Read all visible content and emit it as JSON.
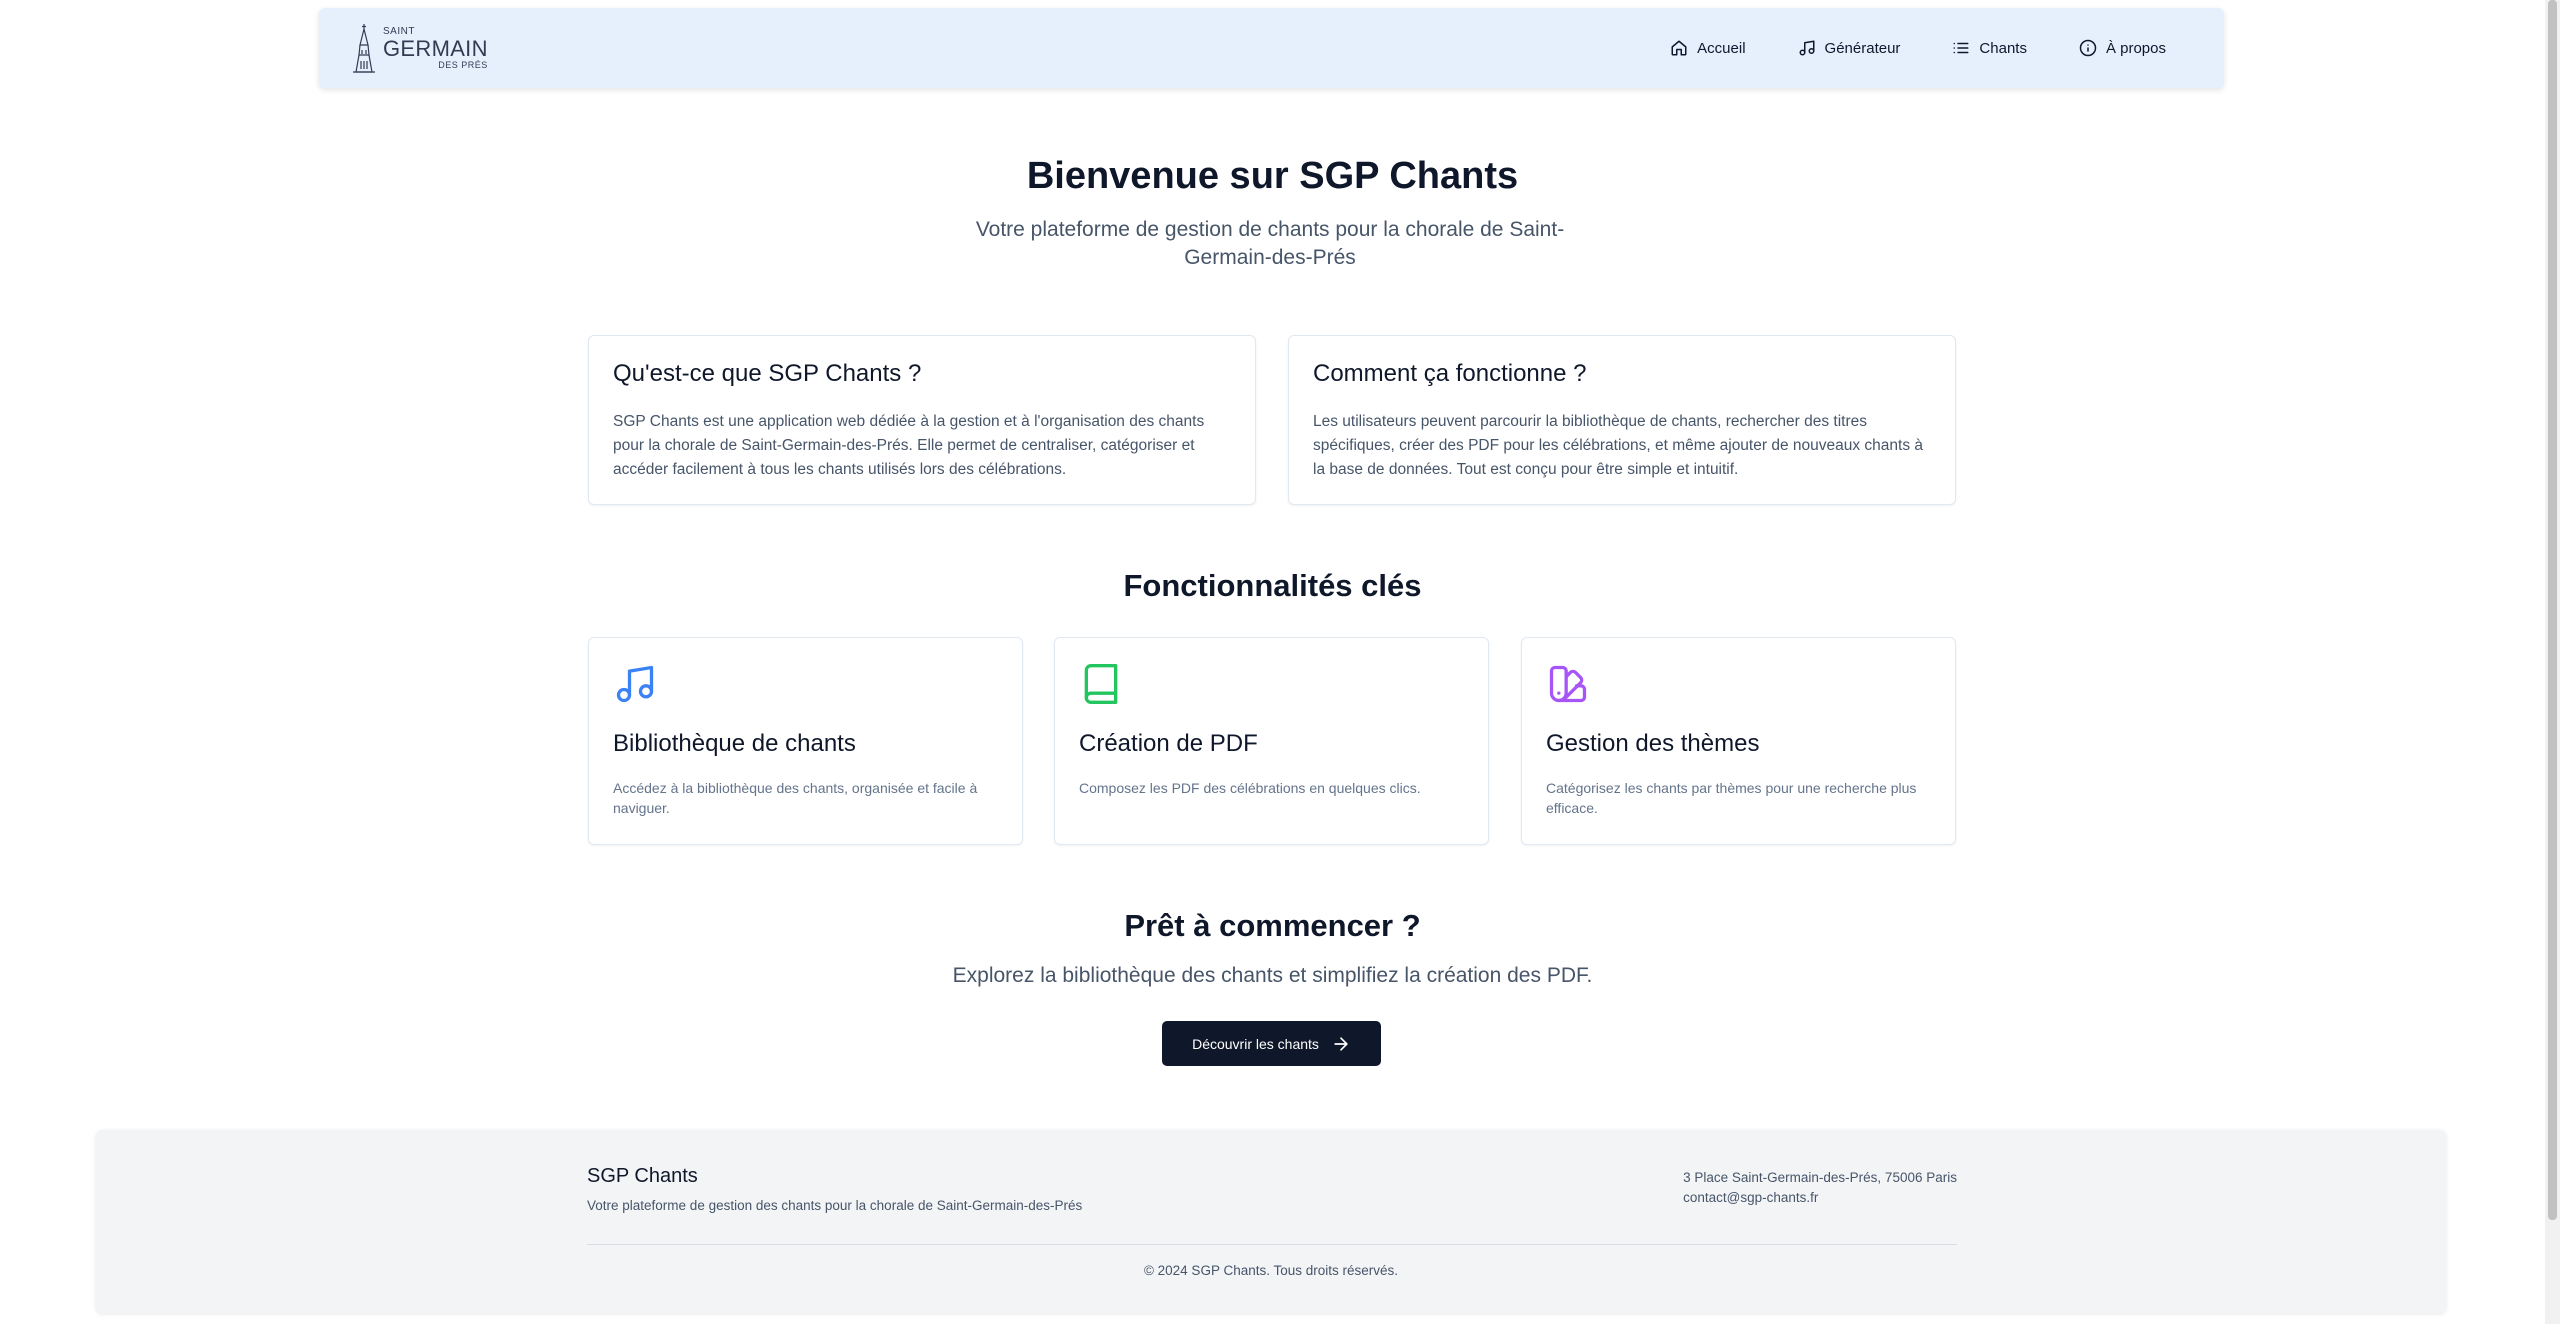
{
  "logo": {
    "saint": "SAINT",
    "germain": "GERMAIN",
    "des": "DES PRÉS"
  },
  "nav": [
    {
      "label": "Accueil",
      "icon": "home-icon"
    },
    {
      "label": "Générateur",
      "icon": "music-icon"
    },
    {
      "label": "Chants",
      "icon": "list-icon"
    },
    {
      "label": "À propos",
      "icon": "info-icon"
    }
  ],
  "hero": {
    "title": "Bienvenue sur SGP Chants",
    "subtitle": "Votre plateforme de gestion de chants pour la chorale de Saint-Germain-des-Prés"
  },
  "info_cards": [
    {
      "title": "Qu'est-ce que SGP Chants ?",
      "text": "SGP Chants est une application web dédiée à la gestion et à l'organisation des chants pour la chorale de Saint-Germain-des-Prés. Elle permet de centraliser, catégoriser et accéder facilement à tous les chants utilisés lors des célébrations."
    },
    {
      "title": "Comment ça fonctionne ?",
      "text": "Les utilisateurs peuvent parcourir la bibliothèque de chants, rechercher des titres spécifiques, créer des PDF pour les célébrations, et même ajouter de nouveaux chants à la base de données. Tout est conçu pour être simple et intuitif."
    }
  ],
  "features_title": "Fonctionnalités clés",
  "features": [
    {
      "title": "Bibliothèque de chants",
      "text": "Accédez à la bibliothèque des chants, organisée et facile à naviguer.",
      "icon": "music-note-icon",
      "color": "#3b82f6"
    },
    {
      "title": "Création de PDF",
      "text": "Composez les PDF des célébrations en quelques clics.",
      "icon": "book-icon",
      "color": "#22c55e"
    },
    {
      "title": "Gestion des thèmes",
      "text": "Catégorisez les chants par thèmes pour une recherche plus efficace.",
      "icon": "swatch-book-icon",
      "color": "#a855f7"
    }
  ],
  "cta": {
    "title": "Prêt à commencer ?",
    "subtitle": "Explorez la bibliothèque des chants et simplifiez la création des PDF.",
    "button": "Découvrir les chants"
  },
  "footer": {
    "brand": "SGP Chants",
    "tagline": "Votre plateforme de gestion des chants pour la chorale de Saint-Germain-des-Prés",
    "address": "3 Place Saint-Germain-des-Prés, 75006 Paris",
    "email": "contact@sgp-chants.fr",
    "copyright": "© 2024 SGP Chants. Tous droits réservés."
  },
  "colors": {
    "primary": "#0f172a",
    "nav_bg": "#e6f0fd",
    "footer_bg": "#f3f4f6"
  }
}
